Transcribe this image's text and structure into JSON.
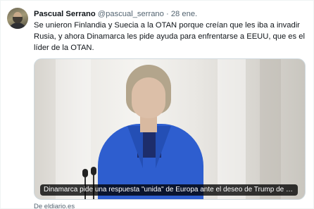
{
  "author": {
    "name": "Pascual Serrano",
    "handle": "@pascual_serrano",
    "separator": "·",
    "time": "28 ene."
  },
  "tweet": {
    "text": "Se unieron Finlandia y Suecia a la OTAN porque creían que les iba a invadir Rusia, y ahora Dinamarca les pide ayuda para enfrentarse a EEUU, que es el líder de la OTAN."
  },
  "card": {
    "caption": "Dinamarca pide una respuesta \"unida\" de Europa ante el deseo de Trump de q…",
    "source": "De eldiario.es",
    "image_icon": "news-photo"
  },
  "colors": {
    "text_primary": "#0f1419",
    "text_secondary": "#536471",
    "border": "#cfd9de",
    "jacket_blue": "#2e5ecf"
  }
}
